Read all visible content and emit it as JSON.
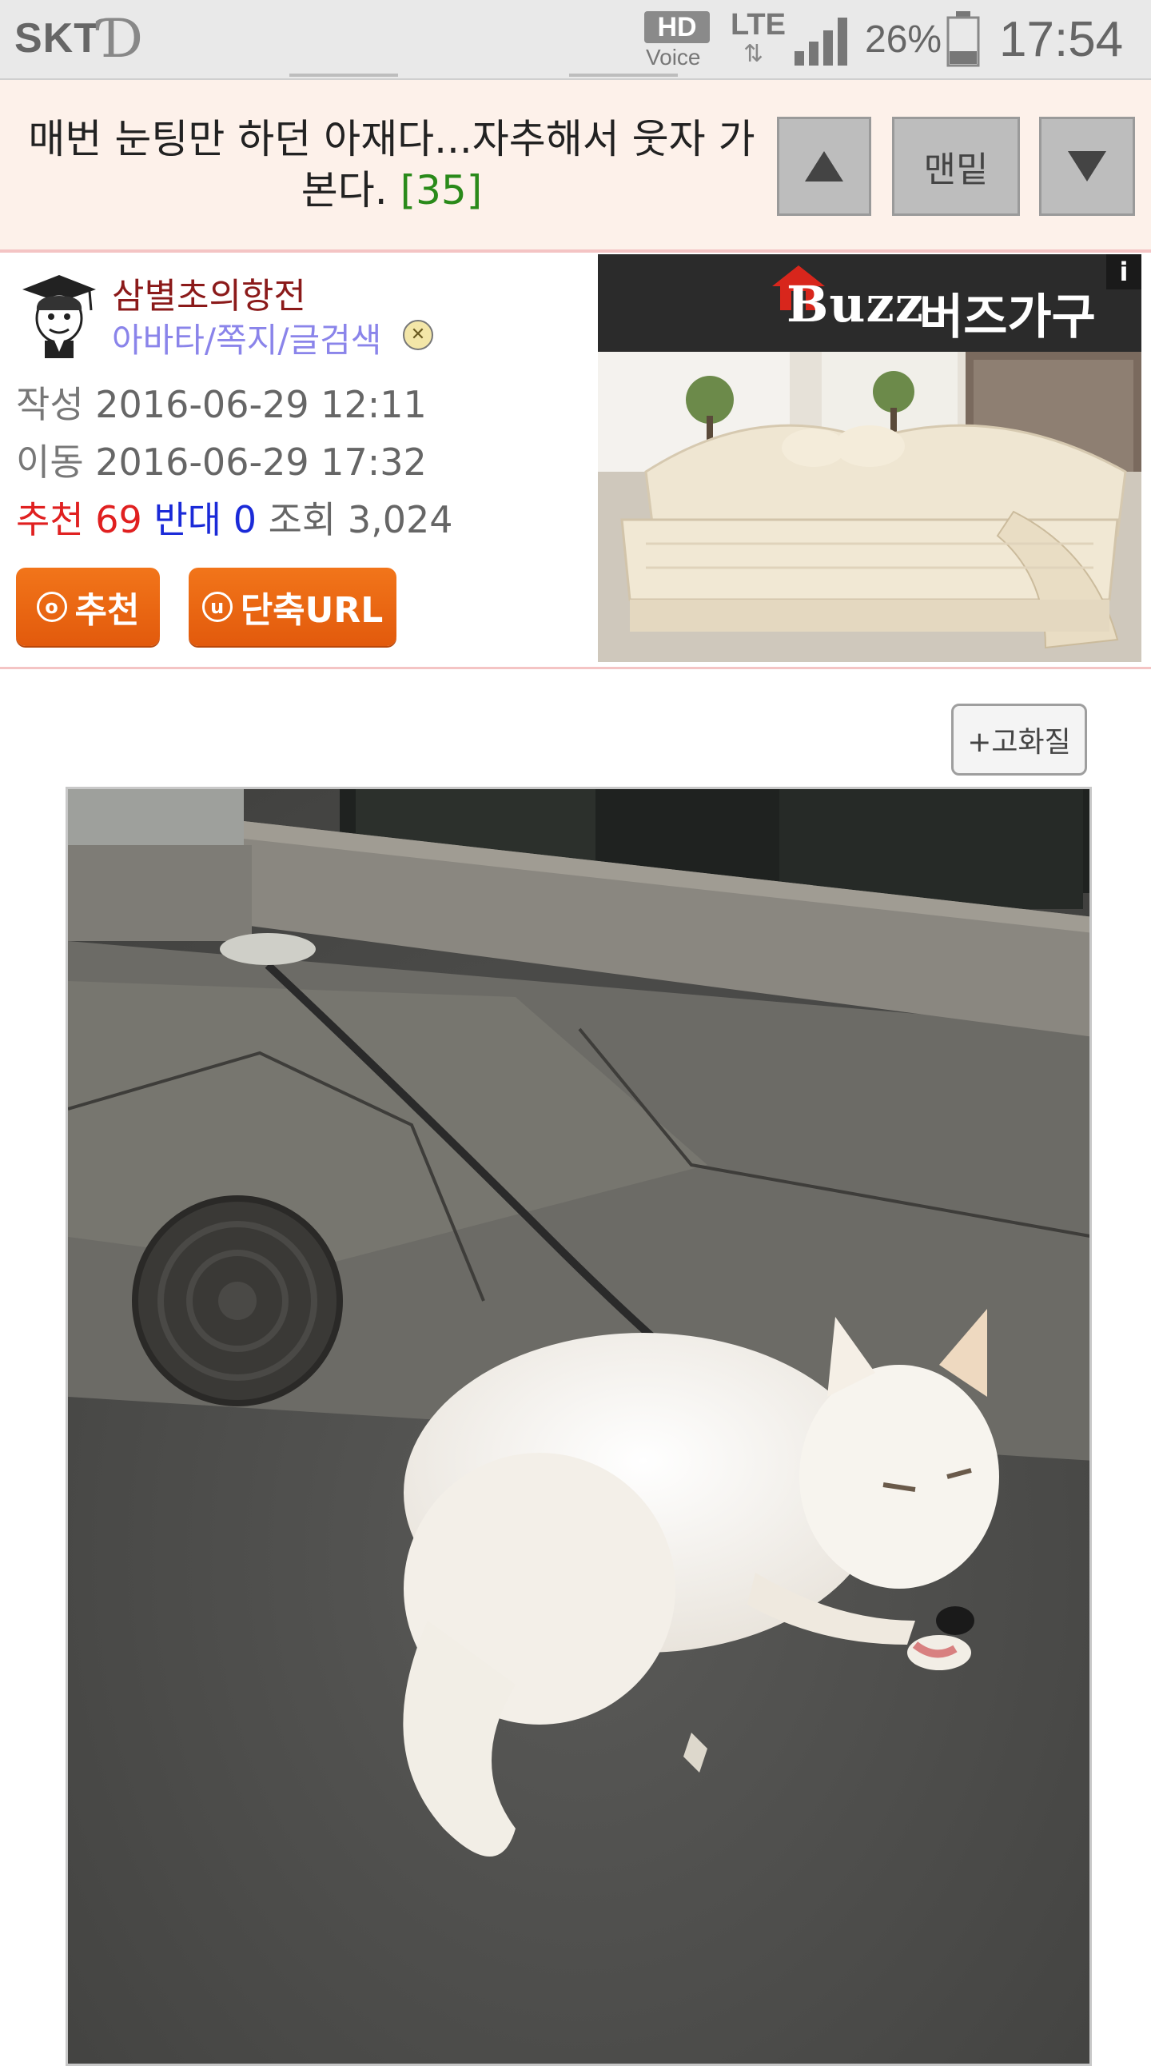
{
  "status_bar": {
    "carrier": "SKT",
    "carrier_logo": "Ɗ",
    "hd_badge": "HD",
    "voice": "Voice",
    "network": "LTE",
    "battery_percent": "26%",
    "time": "17:54"
  },
  "title_bar": {
    "title": "매번 눈팅만 하던 아재다...자추해서 웃자 가본다.",
    "comment_count": "[35]",
    "bottom_label": "맨밑"
  },
  "post_info": {
    "author": "삼별초의항전",
    "author_links": "아바타/쪽지/글검색",
    "written_label": "작성",
    "written_value": "2016-06-29 12:11",
    "moved_label": "이동",
    "moved_value": "2016-06-29 17:32",
    "recommend_label": "추천",
    "recommend_value": "69",
    "oppose_label": "반대",
    "oppose_value": "0",
    "views_label": "조회",
    "views_value": "3,024",
    "recommend_button": "추천",
    "short_url_button": "단축URL"
  },
  "ad": {
    "brand": "Buzz",
    "brand_korean": "버즈가구",
    "info_label": "i"
  },
  "content": {
    "hq_button": "+고화질",
    "image_subject": "white dog lying on pavement"
  }
}
